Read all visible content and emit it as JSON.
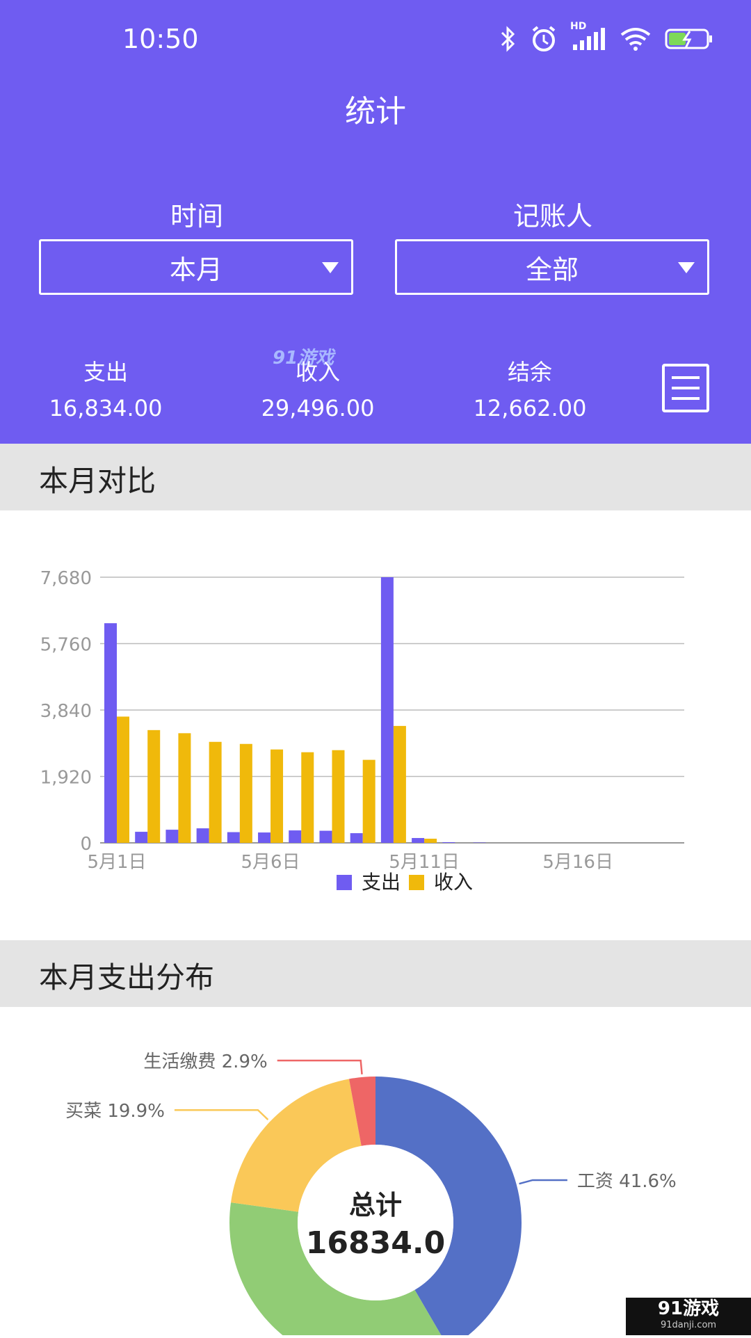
{
  "status_bar": {
    "time": "10:50",
    "network_badge": "HD"
  },
  "header": {
    "title": "统计"
  },
  "filters": {
    "time_label": "时间",
    "time_value": "本月",
    "bookkeeper_label": "记账人",
    "bookkeeper_value": "全部"
  },
  "summary": {
    "expense_label": "支出",
    "expense_value": "16,834.00",
    "income_label": "收入",
    "income_value": "29,496.00",
    "balance_label": "结余",
    "balance_value": "12,662.00"
  },
  "watermark": "91游戏",
  "sections": {
    "comparison_title": "本月对比",
    "distribution_title": "本月支出分布"
  },
  "chart_data": [
    {
      "type": "bar",
      "x": [
        "5月1日",
        "5月2日",
        "5月3日",
        "5月4日",
        "5月5日",
        "5月6日",
        "5月7日",
        "5月8日",
        "5月9日",
        "5月10日",
        "5月11日",
        "5月12日",
        "5月13日",
        "5月14日",
        "5月15日",
        "5月16日",
        "5月17日",
        "5月18日",
        "5月19日"
      ],
      "xticks": [
        "5月1日",
        "5月6日",
        "5月11日",
        "5月16日"
      ],
      "yticks": [
        "0",
        "1,920",
        "3,840",
        "5,760",
        "7,680"
      ],
      "ylim": [
        0,
        7680
      ],
      "series": [
        {
          "name": "支出",
          "color": "#6f5cf1",
          "values": [
            6350,
            320,
            380,
            420,
            310,
            300,
            360,
            350,
            280,
            7680,
            140,
            20,
            10,
            0,
            0,
            0,
            0,
            0,
            0
          ]
        },
        {
          "name": "收入",
          "color": "#f0b90b",
          "values": [
            3650,
            3260,
            3170,
            2920,
            2860,
            2700,
            2620,
            2680,
            2400,
            3380,
            120,
            0,
            0,
            0,
            0,
            0,
            0,
            0,
            0
          ]
        }
      ],
      "grid": true,
      "legend": "bottom"
    },
    {
      "type": "pie",
      "center_label": "总计",
      "center_value": "16834.0",
      "slices": [
        {
          "label": "工资",
          "percent": 41.6,
          "color": "#5470c6",
          "label_text": "工资  41.6%"
        },
        {
          "label": "",
          "percent": 35.6,
          "color": "#91cc75",
          "label_text": ""
        },
        {
          "label": "买菜",
          "percent": 19.9,
          "color": "#fac858",
          "label_text": "买菜  19.9%"
        },
        {
          "label": "生活缴费",
          "percent": 2.9,
          "color": "#ee6666",
          "label_text": "生活缴费  2.9%"
        }
      ]
    }
  ],
  "footer_brand": {
    "name": "91游戏",
    "url": "91danji.com"
  }
}
